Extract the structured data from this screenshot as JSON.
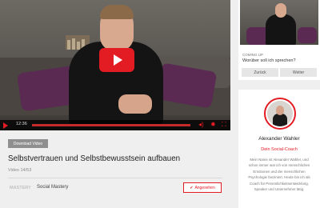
{
  "player": {
    "time": "12:36",
    "colors": {
      "accent": "#e31b23",
      "progress": "#c52a2a"
    },
    "icons": [
      "play-icon",
      "volume-icon",
      "settings-icon",
      "fullscreen-icon"
    ]
  },
  "download_label": "Download Video",
  "video": {
    "title": "Selbstvertrauen und Selbstbewusstsein aufbauen",
    "count": "Video 14/53",
    "brand_logo": "MASTERY",
    "brand": "Social Mastery",
    "ansehen_label": "Angesehen"
  },
  "next": {
    "coming_up": "COMING UP",
    "title": "Worüber soll ich sprechen?",
    "back_label": "Zurück",
    "next_label": "Weiter"
  },
  "coach": {
    "name": "Alexander Wahler",
    "role": "Dein Social-Coach",
    "bio": "Mein Name ist Alexander Wahler, und schon immer war ich von menschlichen Emotionen und der menschlichen Psychologie fasziniert. Heute bin ich als Coach für Persönlichkeitsentwicklung, Speaker und Unternehmer tätig."
  }
}
